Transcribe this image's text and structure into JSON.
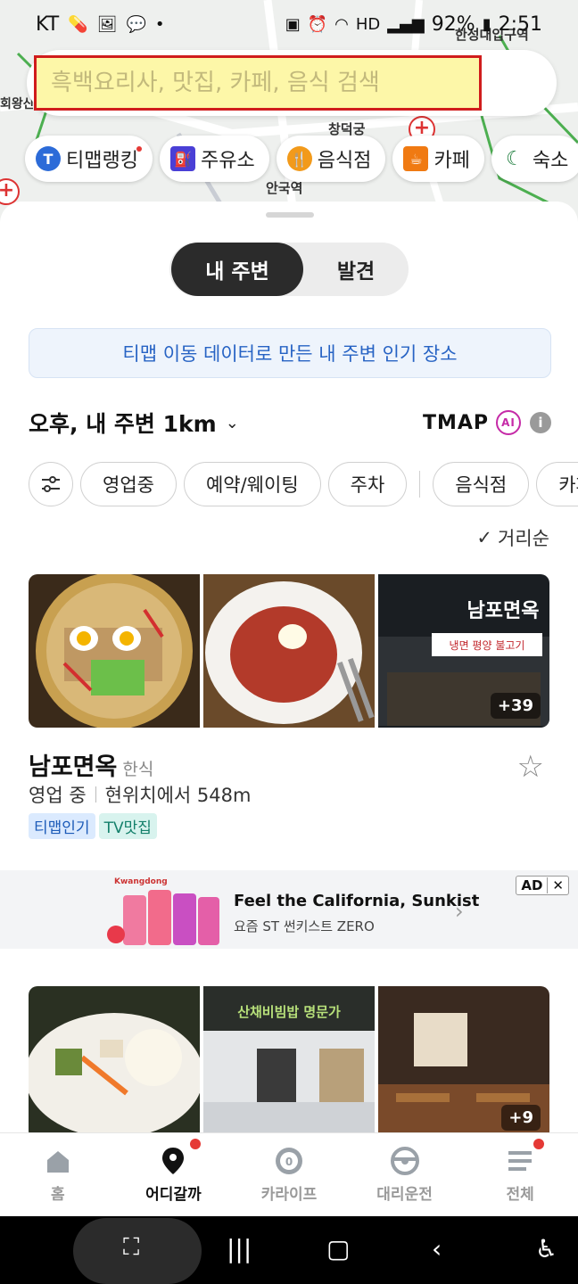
{
  "status": {
    "carrier": "KT",
    "battery": "92%",
    "time": "2:51"
  },
  "map": {
    "labels": [
      "한성대입구역",
      "창덕궁",
      "안국역",
      "회왕산"
    ]
  },
  "search": {
    "placeholder": "흑백요리사, 맛집, 카페, 음식 검색"
  },
  "categories": [
    {
      "label": "티맵랭킹",
      "icon": "tmap-ranking-icon",
      "color": "#2c6bd8"
    },
    {
      "label": "주유소",
      "icon": "gas-station-icon",
      "color": "#4a3fd6"
    },
    {
      "label": "음식점",
      "icon": "restaurant-icon",
      "color": "#f29a1b"
    },
    {
      "label": "카페",
      "icon": "coffee-icon",
      "color": "#f07a12"
    },
    {
      "label": "숙소",
      "icon": "moon-icon",
      "color": "#1a7b3a"
    }
  ],
  "segment": {
    "active": "내 주변",
    "inactive": "발견"
  },
  "banner": "티맵 이동 데이터로 만든 내 주변 인기 장소",
  "location_filter": "오후, 내 주변 1km",
  "brand": "TMAP",
  "ai_badge": "AI",
  "filters": [
    "영업중",
    "예약/웨이팅",
    "주차",
    "음식점",
    "카페"
  ],
  "sort": "거리순",
  "place1": {
    "name": "남포면옥",
    "category": "한식",
    "status": "영업 중",
    "distance": "현위치에서 548m",
    "tags": [
      "티맵인기",
      "TV맛집"
    ],
    "more_photos": "+39",
    "sign_text": "남포면옥"
  },
  "ad": {
    "brand": "Kwangdong",
    "title": "Feel the California, Sunkist",
    "subtitle": "요즘 ST 썬키스트 ZERO",
    "badge": "AD",
    "close": "✕"
  },
  "place2": {
    "more_photos": "+9"
  },
  "bottom_nav": [
    {
      "label": "홈",
      "icon": "home-icon",
      "active": false
    },
    {
      "label": "어디갈까",
      "icon": "location-pin-icon",
      "active": true
    },
    {
      "label": "카라이프",
      "icon": "car-life-icon",
      "active": false
    },
    {
      "label": "대리운전",
      "icon": "steering-wheel-icon",
      "active": false
    },
    {
      "label": "전체",
      "icon": "menu-icon",
      "active": false
    }
  ],
  "colors": {
    "search_highlight": "#fdf7a8",
    "search_border": "#d01c1c",
    "banner_text": "#2763c4",
    "notification_dot": "#e53935"
  }
}
